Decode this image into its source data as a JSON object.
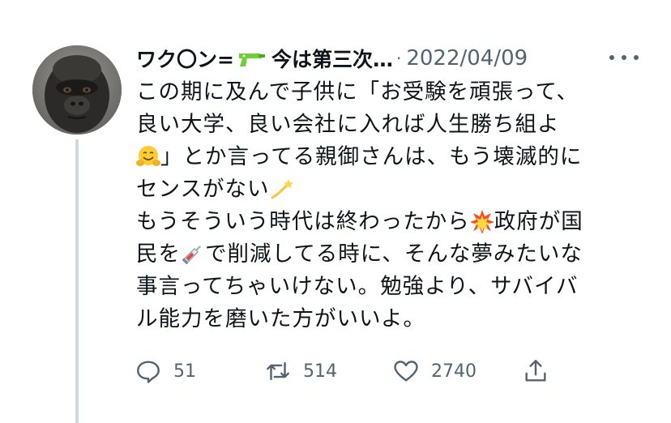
{
  "tweet": {
    "author": {
      "display_name_start": "ワク〇ン=",
      "display_name_end": "今は第三次…",
      "separator": "·"
    },
    "date": "2022/04/09",
    "body": {
      "line1": "この期に及んで子供に「お受験を頑張って、",
      "line2": "良い大学、良い会社に入れば人生勝ち組よ",
      "line3_after_emoji": "」とか言ってる親御さんは、もう壊滅的に",
      "line4": "センスがない",
      "line5_before_emoji": "もうそういう時代は終わったから",
      "line5_after_emoji": "政府が国",
      "line6_before_emoji": "民を",
      "line6_after_emoji": "で削減してる時に、そんな夢みたいな",
      "line7": "事言ってちゃいけない。勉強より、サバイバ",
      "line8": "ル能力を磨いた方がいいよ。"
    },
    "emojis": [
      "water-pistol-icon",
      "hugging-face-icon",
      "dizzy-icon",
      "collision-icon",
      "syringe-icon"
    ],
    "actions": {
      "reply_count": "51",
      "retweet_count": "514",
      "like_count": "2740"
    }
  },
  "colors": {
    "text": "#0f1419",
    "secondary": "#536471",
    "thread_line": "#cfd9de"
  }
}
